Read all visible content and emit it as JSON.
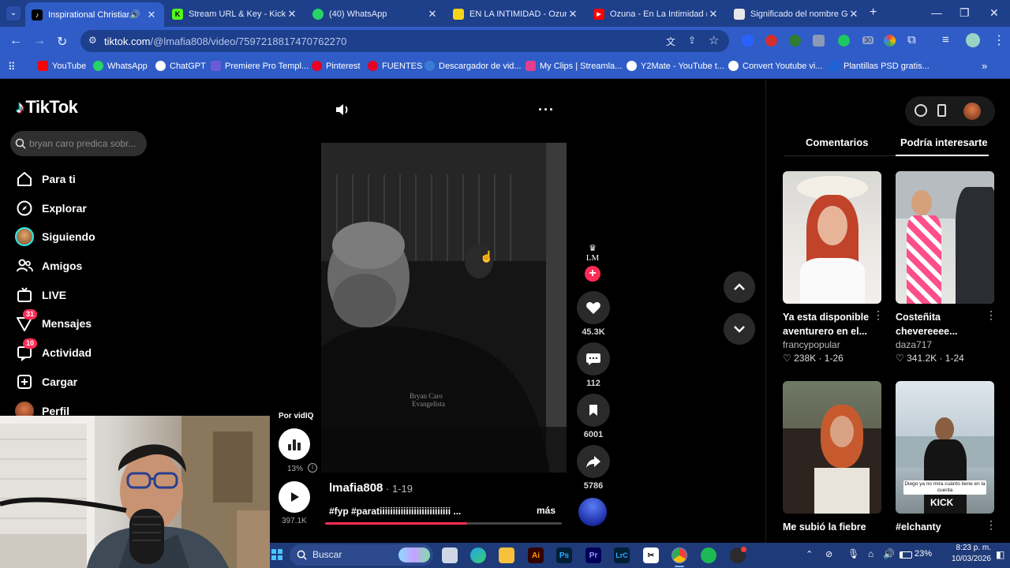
{
  "browser": {
    "tabs": [
      {
        "title": "Inspirational Christian I",
        "active": true,
        "color": "#000000"
      },
      {
        "title": "Stream URL & Key - Kick D",
        "active": false,
        "color": "#53fc18"
      },
      {
        "title": "(40) WhatsApp",
        "active": false,
        "color": "#25d366"
      },
      {
        "title": "EN LA INTIMIDAD - Ozuna",
        "active": false,
        "color": "#f5d31a"
      },
      {
        "title": "Ozuna - En La Intimidad (V",
        "active": false,
        "color": "#ff0000"
      },
      {
        "title": "Significado del nombre Gi",
        "active": false,
        "color": "#e8e8e8"
      }
    ],
    "url_host": "tiktok.com",
    "url_path": "/@lmafia808/video/7597218817470762270",
    "bookmarks": [
      {
        "label": "YouTube",
        "color": "#ff0000"
      },
      {
        "label": "WhatsApp",
        "color": "#25d366"
      },
      {
        "label": "ChatGPT",
        "color": "#ffffff"
      },
      {
        "label": "Premiere Pro Templ...",
        "color": "#6b5bd6"
      },
      {
        "label": "Pinterest",
        "color": "#e60023"
      },
      {
        "label": "FUENTES",
        "color": "#e60023"
      },
      {
        "label": "Descargador de vid...",
        "color": "#3a7bd5"
      },
      {
        "label": "My Clips | Streamla...",
        "color": "#e83e8c"
      },
      {
        "label": "Y2Mate - YouTube t...",
        "color": "#ffffff"
      },
      {
        "label": "Convert Youtube vi...",
        "color": "#ffffff"
      },
      {
        "label": "Plantillas PSD gratis...",
        "color": "#1e63d6"
      }
    ],
    "ext_badge": "30"
  },
  "tiktok": {
    "brand": "TikTok",
    "search_placeholder": "bryan caro predica sobr...",
    "nav": [
      {
        "label": "Para ti",
        "icon": "home-icon",
        "badge": ""
      },
      {
        "label": "Explorar",
        "icon": "compass-icon",
        "badge": ""
      },
      {
        "label": "Siguiendo",
        "icon": "following-avatar-icon",
        "badge": ""
      },
      {
        "label": "Amigos",
        "icon": "friends-icon",
        "badge": ""
      },
      {
        "label": "LIVE",
        "icon": "live-icon",
        "badge": ""
      },
      {
        "label": "Mensajes",
        "icon": "messages-icon",
        "badge": "31"
      },
      {
        "label": "Actividad",
        "icon": "activity-icon",
        "badge": "10"
      },
      {
        "label": "Cargar",
        "icon": "upload-icon",
        "badge": ""
      },
      {
        "label": "Perfil",
        "icon": "profile-avatar-icon",
        "badge": ""
      }
    ],
    "video": {
      "author": "lmafia808",
      "date": "· 1-19",
      "caption": "#fyp #paratiiiiiiiiiiiiiiiiiiiiiiiiiii ...",
      "more": "más",
      "watermark_text_1": "Bryan Caro",
      "watermark_text_2": "Evangelista",
      "progress": 0.6
    },
    "actions": {
      "likes": "45.3K",
      "comments": "112",
      "saves": "6001",
      "shares": "5786"
    },
    "vidiq": {
      "by": "Por vidIQ",
      "percent": "13%",
      "views": "397.1K"
    },
    "right_tabs": [
      "Comentarios",
      "Podría interesarte"
    ],
    "cards": [
      {
        "title": "Ya esta disponible aventurero en el...",
        "user": "francypopular",
        "stats": "238K · 1-26"
      },
      {
        "title": "Costeñita chevereeee...",
        "user": "daza717",
        "stats": "341.2K · 1-24"
      },
      {
        "title": "Me subió la fiebre",
        "user": "",
        "stats": ""
      },
      {
        "title": "#elchanty",
        "user": "",
        "stats": ""
      }
    ],
    "card_overlays": [
      "Diego ya no mira cuánto tiene en la cuenta",
      "KICK"
    ]
  },
  "taskbar": {
    "search_placeholder": "Buscar",
    "battery": "23%",
    "time": "8:23 p. m.",
    "date": "10/03/2026"
  }
}
